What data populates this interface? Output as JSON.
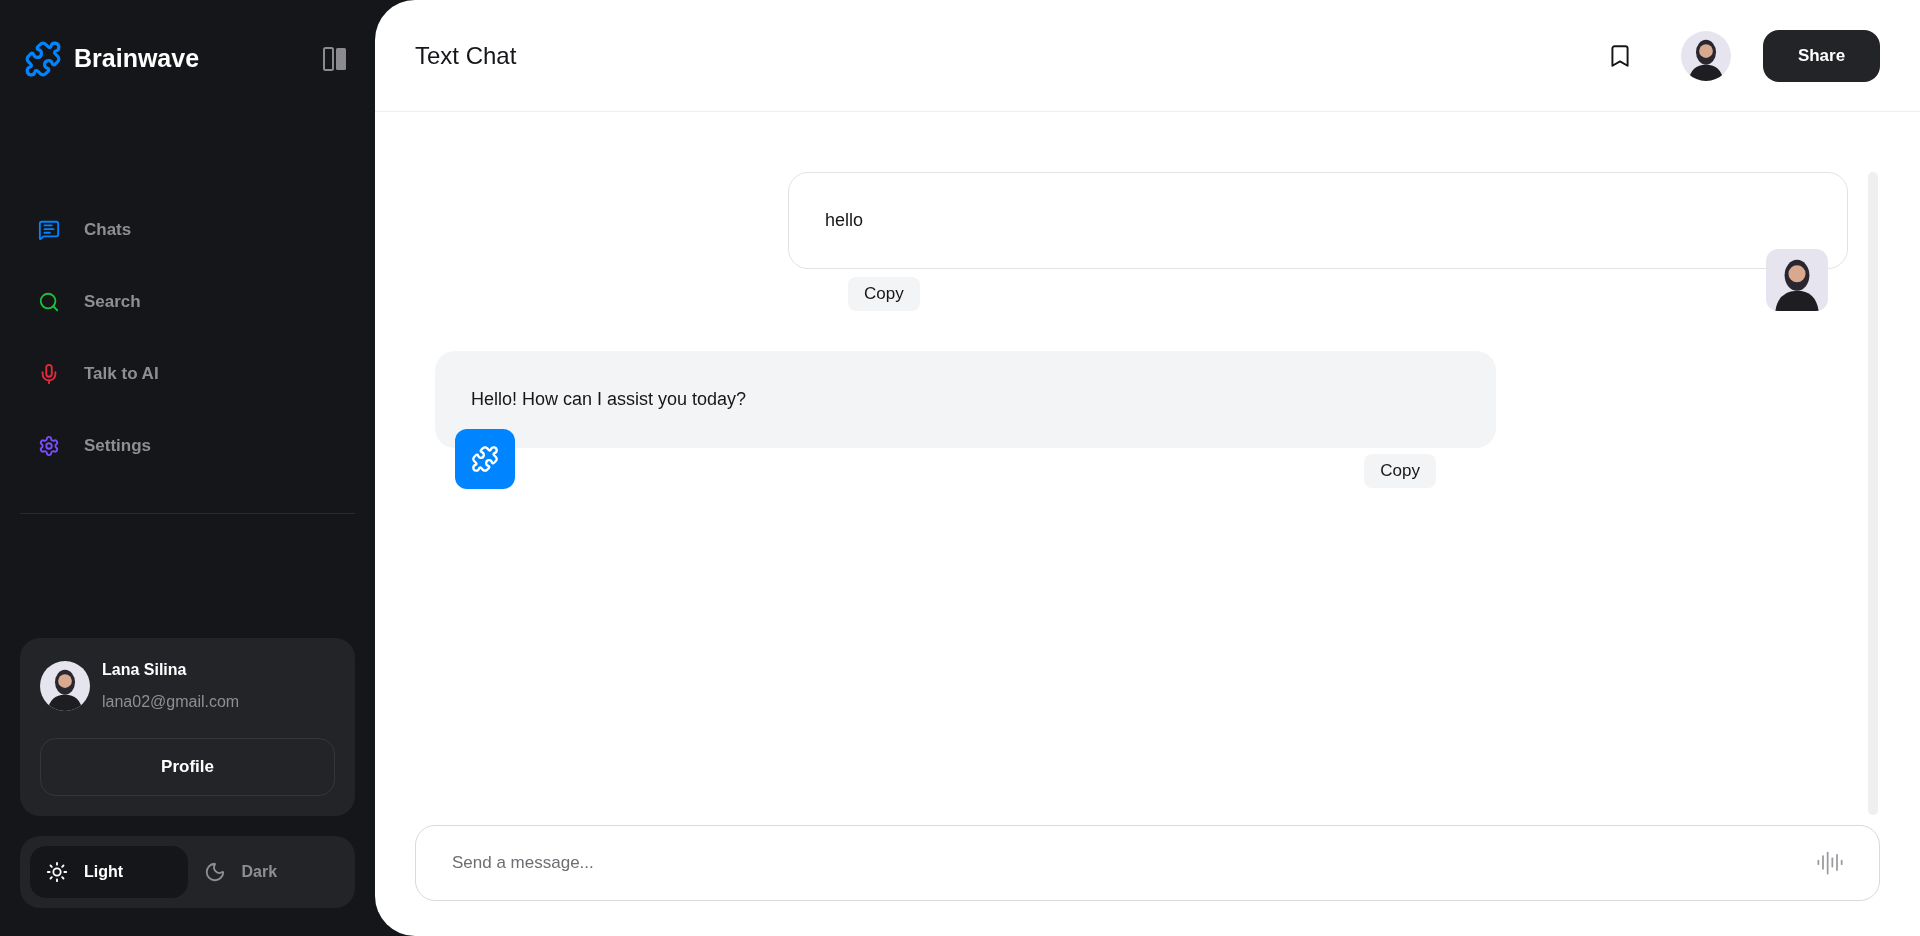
{
  "sidebar": {
    "brand": "Brainwave",
    "nav": [
      {
        "label": "Chats",
        "kind": "chat",
        "color": "#0084ff"
      },
      {
        "label": "Search",
        "kind": "search",
        "color": "#1fbf3a"
      },
      {
        "label": "Talk to AI",
        "kind": "mic",
        "color": "#e8293d"
      },
      {
        "label": "Settings",
        "kind": "gear",
        "color": "#7b4dff"
      }
    ],
    "user": {
      "name": "Lana Silina",
      "email": "lana02@gmail.com",
      "button": "Profile"
    },
    "theme": [
      {
        "label": "Light",
        "kind": "sun",
        "selected": true
      },
      {
        "label": "Dark",
        "kind": "moon",
        "selected": false
      }
    ]
  },
  "header": {
    "title": "Text Chat",
    "button": "Share"
  },
  "messages": [
    {
      "kind": "user",
      "text": "hello",
      "action": "Copy"
    },
    {
      "kind": "ai",
      "text": "Hello! How can I assist you today?",
      "action": "Copy"
    }
  ],
  "composer": {
    "placeholder": "Send a message..."
  }
}
